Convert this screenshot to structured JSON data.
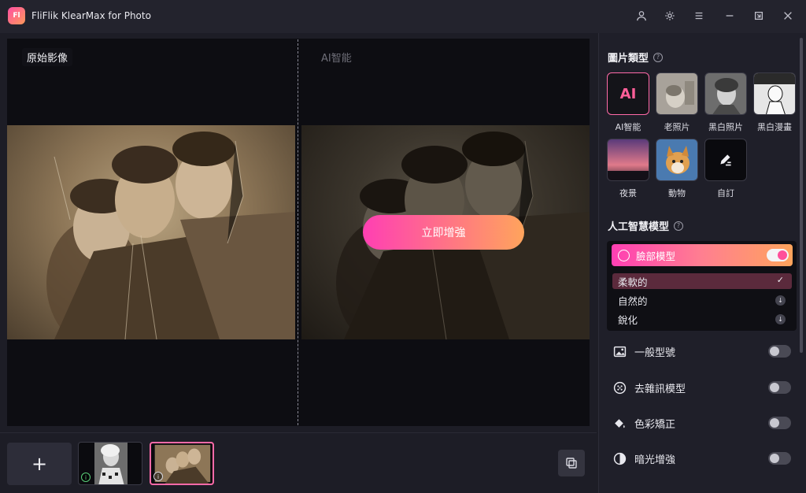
{
  "window": {
    "title": "FliFlik KlearMax for Photo",
    "logo_text": "Fl"
  },
  "titlebar_buttons": [
    "user-icon",
    "settings-icon",
    "menu-icon",
    "minimize-icon",
    "maximize-icon",
    "close-icon"
  ],
  "preview": {
    "original_label": "原始影像",
    "ai_label": "AI智能",
    "enhance_button": "立即增強"
  },
  "bottom": {
    "add_label": "+",
    "thumbnails": [
      {
        "info": "i",
        "active": false
      },
      {
        "info": "i",
        "active": true
      }
    ]
  },
  "panel": {
    "image_type_title": "圖片類型",
    "image_types": [
      {
        "label": "AI智能",
        "card_text": "AI",
        "selected": true
      },
      {
        "label": "老照片",
        "selected": false
      },
      {
        "label": "黑白照片",
        "selected": false
      },
      {
        "label": "黑白漫畫",
        "selected": false
      },
      {
        "label": "夜景",
        "selected": false
      },
      {
        "label": "動物",
        "selected": false
      },
      {
        "label": "自訂",
        "selected": false
      }
    ],
    "ai_model_title": "人工智慧模型",
    "face_model": {
      "label": "臉部模型",
      "enabled": true,
      "options": [
        {
          "label": "柔軟的",
          "selected": true
        },
        {
          "label": "自然的",
          "selected": false
        },
        {
          "label": "銳化",
          "selected": false
        }
      ]
    },
    "features": [
      {
        "label": "一般型號",
        "icon": "image-icon",
        "enabled": false
      },
      {
        "label": "去雜訊模型",
        "icon": "denoise-icon",
        "enabled": false
      },
      {
        "label": "色彩矯正",
        "icon": "paint-bucket-icon",
        "enabled": false
      },
      {
        "label": "暗光增強",
        "icon": "contrast-icon",
        "enabled": false
      }
    ]
  },
  "colors": {
    "accent_start": "#ff3fb3",
    "accent_end": "#ffa45c",
    "background": "#1d1d26"
  }
}
